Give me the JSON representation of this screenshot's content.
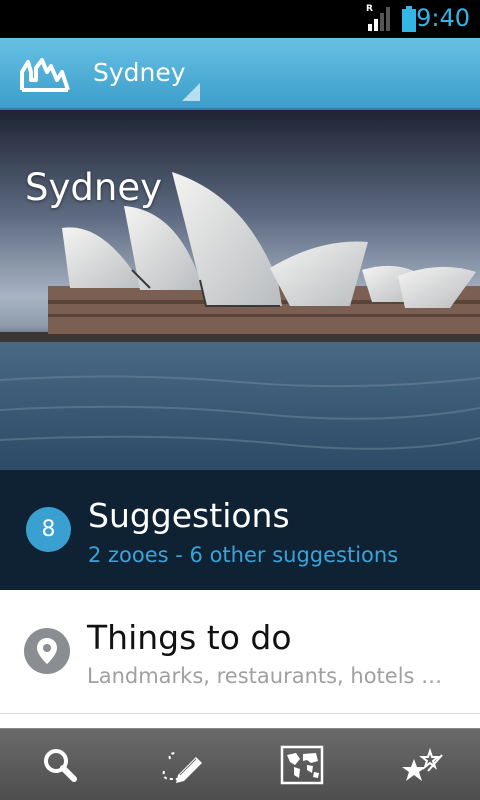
{
  "status_bar": {
    "time": "9:40",
    "roaming_indicator": "R",
    "icons": [
      "signal-icon",
      "battery-icon"
    ]
  },
  "action_bar": {
    "logo_icon": "skyline-logo-icon",
    "title": "Sydney"
  },
  "hero": {
    "title": "Sydney"
  },
  "suggestions": {
    "count": "8",
    "title": "Suggestions",
    "subtitle": "2 zooes - 6 other suggestions"
  },
  "things_to_do": {
    "icon": "location-pin-icon",
    "title": "Things to do",
    "subtitle": "Landmarks, restaurants, hotels …"
  },
  "bottom_bar": {
    "items": [
      {
        "icon": "search-icon"
      },
      {
        "icon": "pencil-icon"
      },
      {
        "icon": "world-map-icon"
      },
      {
        "icon": "favorites-stars-icon"
      }
    ]
  },
  "colors": {
    "accent": "#33b5e5",
    "action_bar": "#4aa8d2",
    "suggestions_bg": "#0f2233",
    "badge": "#3a9fd1"
  }
}
